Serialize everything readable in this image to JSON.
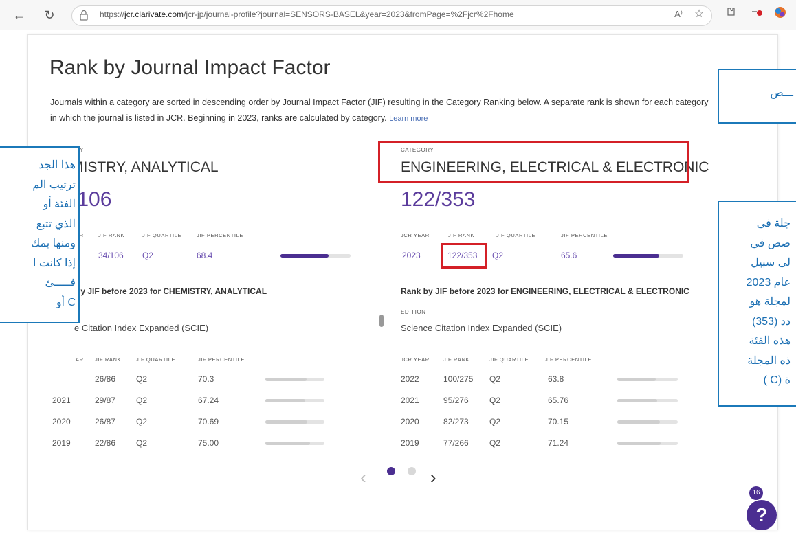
{
  "browser": {
    "url_prefix": "https://",
    "url_domain": "jcr.clarivate.com",
    "url_rest": "/jcr-jp/journal-profile?journal=SENSORS-BASEL&year=2023&fromPage=%2Fjcr%2Fhome",
    "back_icon": "←",
    "refresh_icon": "↻",
    "read_aloud_icon": "A⁾",
    "favorite_icon": "☆",
    "profile_badge_color": "#d42027"
  },
  "page": {
    "title": "Rank by Journal Impact Factor",
    "description": "Journals within a category are sorted in descending order by Journal Impact Factor (JIF) resulting in the Category Ranking below. A separate rank is shown for each category in which the journal is listed in JCR. Beginning in 2023, ranks are calculated by category.",
    "learn_more": "Learn more"
  },
  "labels": {
    "category": "CATEGORY",
    "category_partial": "RY",
    "jcr_year": "JCR YEAR",
    "jcr_year_partial": "AR",
    "jif_rank": "JIF RANK",
    "jif_quartile": "JIF QUARTILE",
    "jif_percentile": "JIF PERCENTILE",
    "edition": "EDITION"
  },
  "left_category": {
    "name_visible": "MISTRY, ANALYTICAL",
    "rank_visible": "/106",
    "current": {
      "jif_rank": "34/106",
      "quartile": "Q2",
      "percentile": "68.4",
      "percentile_value": 68.4
    },
    "sub_heading_visible": "by JIF before 2023 for CHEMISTRY, ANALYTICAL",
    "edition_visible": "e Citation Index Expanded (SCIE)",
    "history": [
      {
        "year": "",
        "rank": "26/86",
        "quartile": "Q2",
        "percentile": "70.3",
        "percentile_value": 70.3
      },
      {
        "year": "2021",
        "rank": "29/87",
        "quartile": "Q2",
        "percentile": "67.24",
        "percentile_value": 67.24
      },
      {
        "year": "2020",
        "rank": "26/87",
        "quartile": "Q2",
        "percentile": "70.69",
        "percentile_value": 70.69
      },
      {
        "year": "2019",
        "rank": "22/86",
        "quartile": "Q2",
        "percentile": "75.00",
        "percentile_value": 75.0
      }
    ]
  },
  "right_category": {
    "name": "ENGINEERING, ELECTRICAL & ELECTRONIC",
    "rank": "122/353",
    "current": {
      "year": "2023",
      "jif_rank": "122/353",
      "quartile": "Q2",
      "percentile": "65.6",
      "percentile_value": 65.6
    },
    "sub_heading": "Rank by JIF before 2023 for ENGINEERING, ELECTRICAL & ELECTRONIC",
    "edition": "Science Citation Index Expanded (SCIE)",
    "history": [
      {
        "year": "2022",
        "rank": "100/275",
        "quartile": "Q2",
        "percentile": "63.8",
        "percentile_value": 63.8
      },
      {
        "year": "2021",
        "rank": "95/276",
        "quartile": "Q2",
        "percentile": "65.76",
        "percentile_value": 65.76
      },
      {
        "year": "2020",
        "rank": "82/273",
        "quartile": "Q2",
        "percentile": "70.15",
        "percentile_value": 70.15
      },
      {
        "year": "2019",
        "rank": "77/266",
        "quartile": "Q2",
        "percentile": "71.24",
        "percentile_value": 71.24
      }
    ]
  },
  "carousel": {
    "prev": "‹",
    "next": "›"
  },
  "help": {
    "badge": "16",
    "label": "?"
  },
  "overlays": {
    "top_right": [
      "ـــص"
    ],
    "left": [
      "هذا الجد",
      "ترتيب الم",
      "الفئة أو",
      "الذي تتبع",
      "ومنها يمك",
      "إذا كانت ا",
      "فـــــئ",
      "C أو"
    ],
    "right": [
      "جلة في",
      "صص في",
      "لى سبيل",
      "عام 2023",
      "لمجلة هو",
      "دد (353)",
      "هذه الفئة",
      "ذه المجلة",
      "ة (C )"
    ]
  },
  "colors": {
    "accent": "#4b2e91",
    "rank_purple": "#5b3c9c",
    "highlight_red": "#d42027",
    "overlay_blue": "#1b79b9"
  }
}
